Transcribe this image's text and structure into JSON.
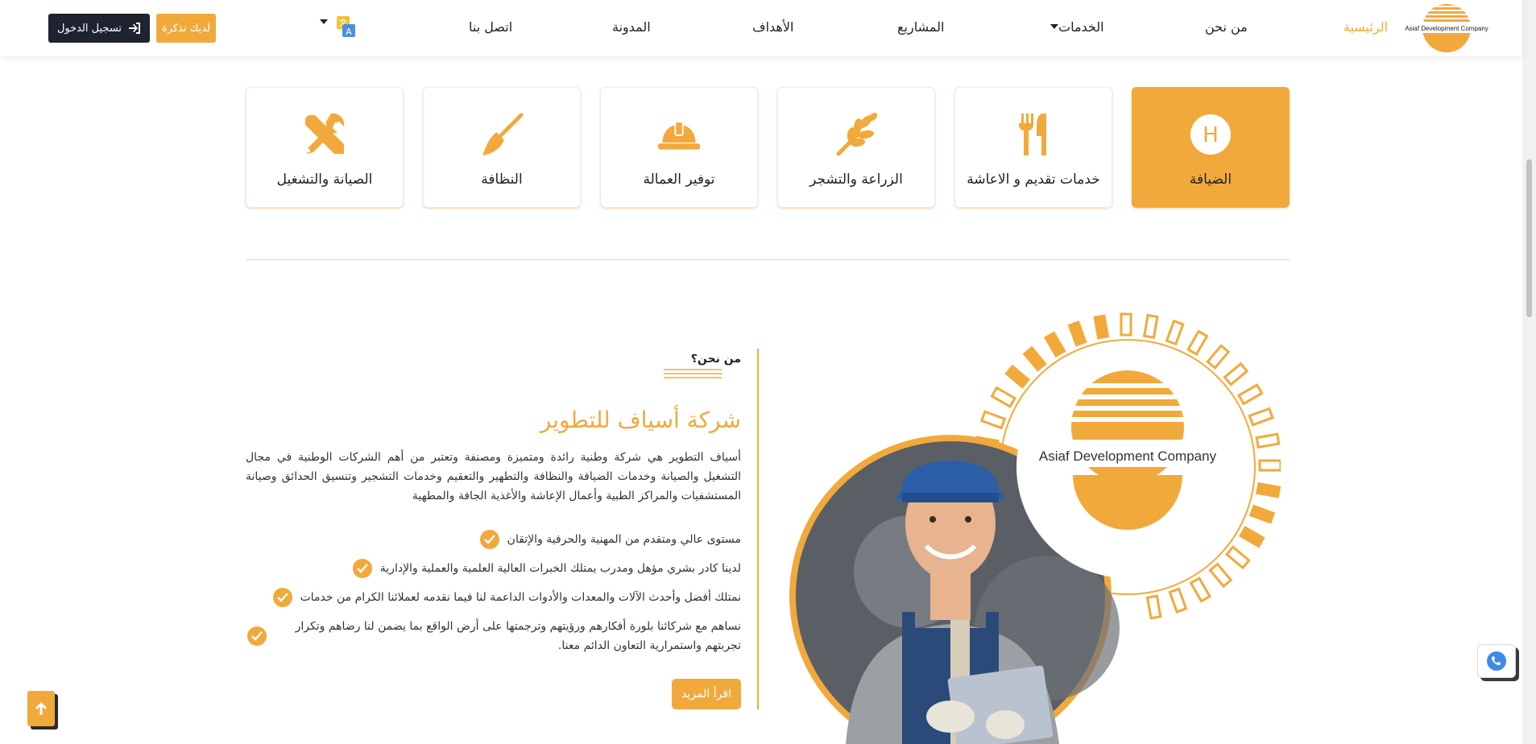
{
  "header": {
    "logo_text": "Asiaf Development Company",
    "nav": {
      "home": "الرئيسية",
      "about": "من نحن",
      "services": "الخدمات",
      "projects": "المشاريع",
      "goals": "الأهداف",
      "blog": "المدونة",
      "contact": "اتصل بنا"
    },
    "ticket_button": "لديك تذكرة",
    "login_button": "تسجيل الدخول"
  },
  "services": [
    {
      "label": "الضيافة",
      "icon": "hotel-icon",
      "active": true
    },
    {
      "label": "خدمات تقديم و الاعاشة",
      "icon": "cutlery-icon",
      "active": false
    },
    {
      "label": "الزراعة والتشجر",
      "icon": "wheat-icon",
      "active": false
    },
    {
      "label": "توفير العمالة",
      "icon": "hard-hat-icon",
      "active": false
    },
    {
      "label": "النظافة",
      "icon": "broom-icon",
      "active": false
    },
    {
      "label": "الصيانة والتشغيل",
      "icon": "tools-icon",
      "active": false
    }
  ],
  "about": {
    "subtitle": "من نحن؟",
    "title": "شركة أسياف للتطوير",
    "description": "أسياف التطوير هي شركة وطنية رائدة ومتميزة ومصنفة وتعتبر من أهم الشركات الوطنية في مجال التشغيل والصيانة وخدمات الضيافة والنظافة والتطهير والتعقيم وخدمات التشجير وتنسيق الحدائق وصيانة المستشفيات والمراكز الطبية وأعمال الإعاشة والأغذية الجافة والمطهية",
    "features": [
      "مستوى عالي ومتقدم من المهنية والحرفية والإتقان",
      "لدينا كادر بشري مؤهل ومدرب يمتلك الخبرات العالية العلمية والعملية والإدارية",
      "نمتلك أفضل وأحدث الآلات والمعدات والأدوات الداعمة لنا فيما نقدمه لعملائنا الكرام من خدمات",
      "نساهم مع شركائنا بلورة أفكارهم ورؤيتهم وترجمتها على أرض الواقع بما يضمن لنا رضاهم وتكرار تجربتهم واستمرارية التعاون الدائم معنا."
    ],
    "read_more": "اقرأ المزيد",
    "badge_text": "Asiaf Development Company"
  },
  "colors": {
    "accent": "#f2a93b",
    "dark": "#1e2330"
  }
}
